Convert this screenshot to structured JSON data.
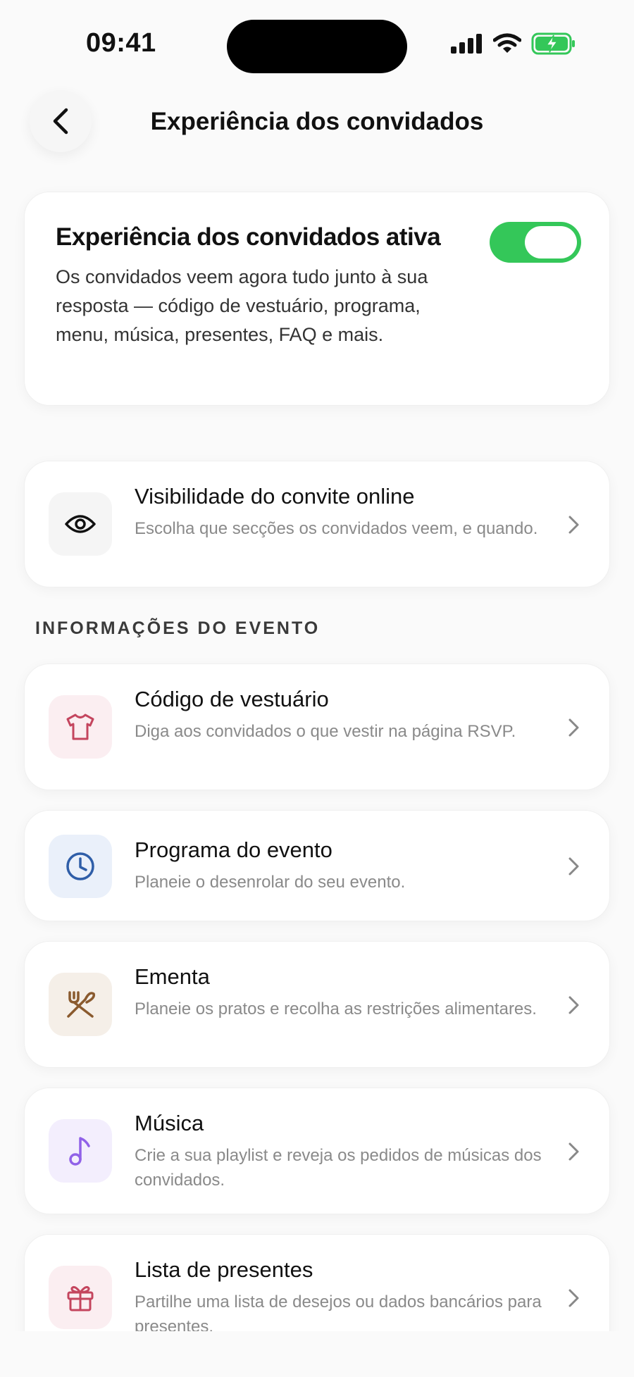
{
  "status_bar": {
    "time": "09:41"
  },
  "header": {
    "title": "Experiência dos convidados",
    "back_icon": "chevron-left-icon"
  },
  "hero": {
    "title": "Experiência dos convidados ativa",
    "description": "Os convidados veem agora tudo junto à sua resposta — código de vestuário, programa, menu, música, presentes, FAQ e mais.",
    "toggle_on": true,
    "toggle_color": "#34c759"
  },
  "visibility": {
    "title": "Visibilidade do convite online",
    "subtitle": "Escolha que secções os convidados veem, e quando.",
    "icon": "eye-icon"
  },
  "section_label": "INFORMAÇÕES DO EVENTO",
  "items": [
    {
      "title": "Código de vestuário",
      "subtitle": "Diga aos convidados o que vestir na página RSVP.",
      "icon": "shirt-icon",
      "tile_color": "#fbeef1",
      "icon_color": "#c4455e"
    },
    {
      "title": "Programa do evento",
      "subtitle": "Planeie o desenrolar do seu evento.",
      "icon": "clock-icon",
      "tile_color": "#eaf0fa",
      "icon_color": "#2f5ea8"
    },
    {
      "title": "Ementa",
      "subtitle": "Planeie os pratos e recolha as restrições alimentares.",
      "icon": "utensils-icon",
      "tile_color": "#f5efe8",
      "icon_color": "#8a5a2e"
    },
    {
      "title": "Música",
      "subtitle": "Crie a sua playlist e reveja os pedidos de músicas dos convidados.",
      "icon": "music-note-icon",
      "tile_color": "#f3eefd",
      "icon_color": "#9061e8"
    },
    {
      "title": "Lista de presentes",
      "subtitle": "Partilhe uma lista de desejos ou dados bancários para presentes.",
      "icon": "gift-icon",
      "tile_color": "#fbeef1",
      "icon_color": "#c4455e"
    }
  ]
}
